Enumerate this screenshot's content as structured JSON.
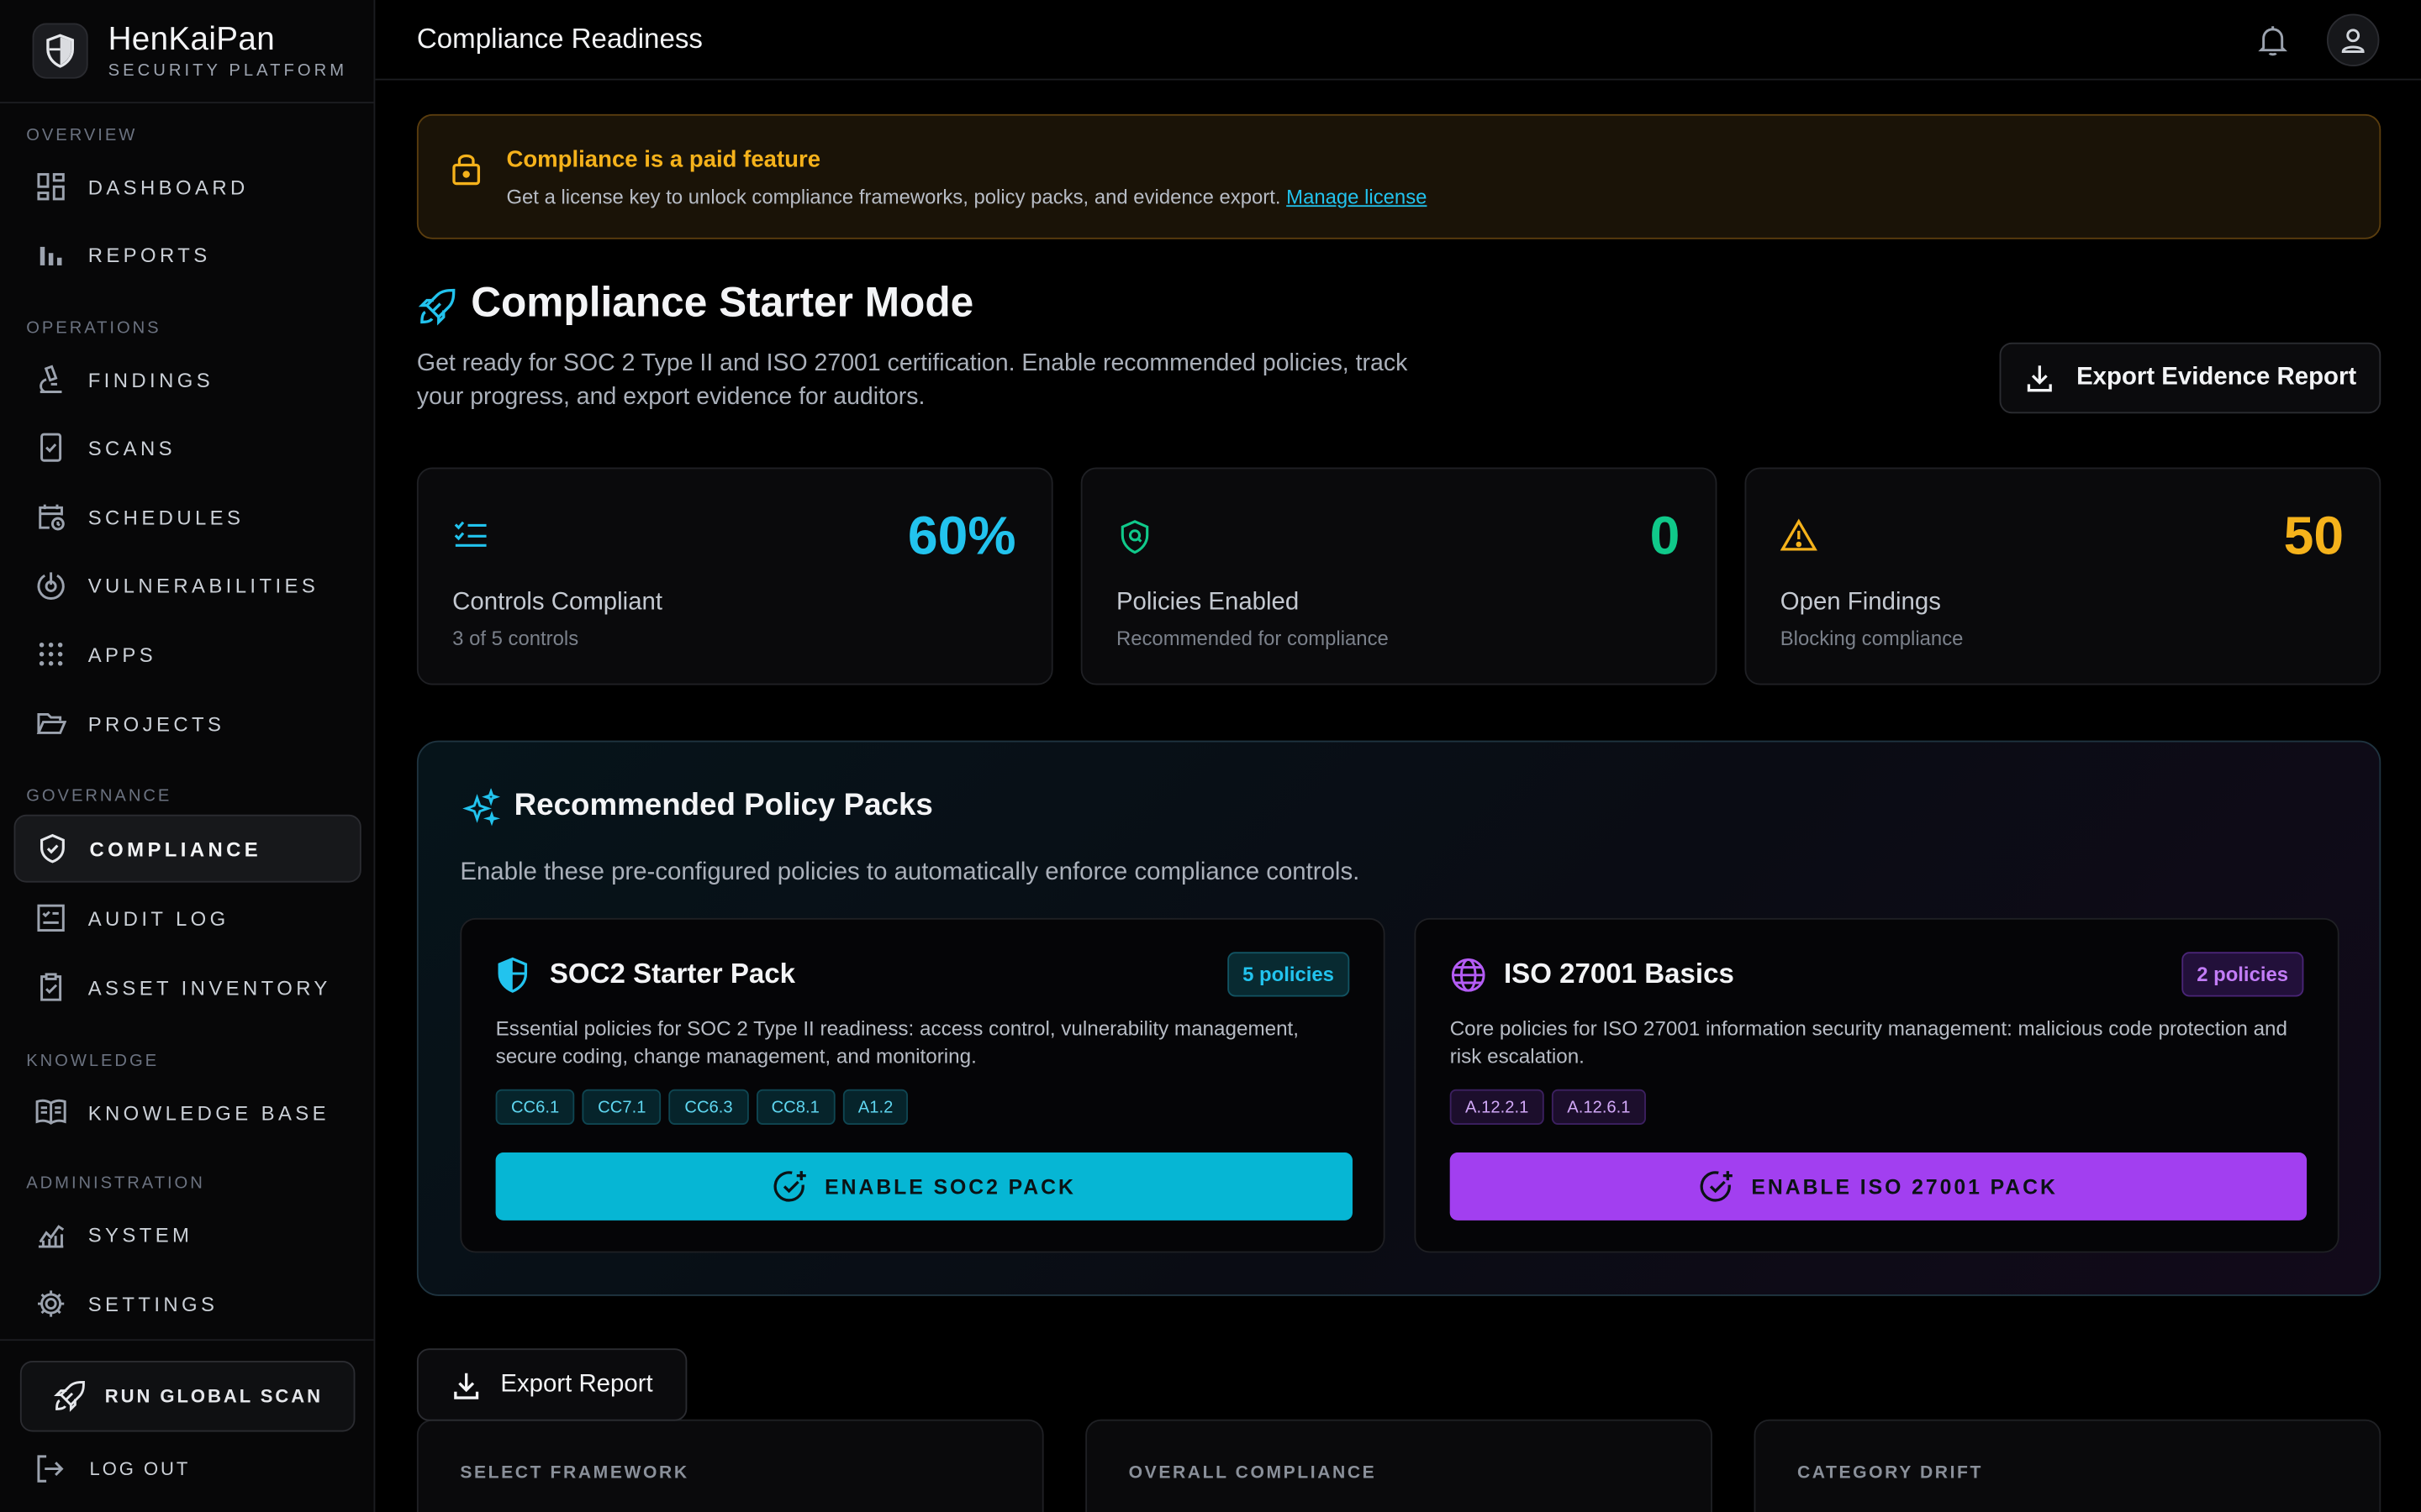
{
  "brand": {
    "name": "HenKaiPan",
    "subtitle": "SECURITY PLATFORM"
  },
  "nav": {
    "overview": "OVERVIEW",
    "operations": "OPERATIONS",
    "governance": "GOVERNANCE",
    "knowledge": "KNOWLEDGE",
    "administration": "ADMINISTRATION",
    "items": {
      "dashboard": "DASHBOARD",
      "reports": "REPORTS",
      "findings": "FINDINGS",
      "scans": "SCANS",
      "schedules": "SCHEDULES",
      "vulnerabilities": "VULNERABILITIES",
      "apps": "APPS",
      "projects": "PROJECTS",
      "compliance": "COMPLIANCE",
      "audit_log": "AUDIT LOG",
      "asset_inventory": "ASSET INVENTORY",
      "knowledge_base": "KNOWLEDGE BASE",
      "system": "SYSTEM",
      "settings": "SETTINGS"
    },
    "active": "compliance",
    "run_global_scan": "RUN GLOBAL SCAN",
    "log_out": "LOG OUT"
  },
  "header": {
    "title": "Compliance Readiness"
  },
  "banner": {
    "title": "Compliance is a paid feature",
    "text": "Get a license key to unlock compliance frameworks, policy packs, and evidence export.",
    "link": "Manage license"
  },
  "starter": {
    "title": "Compliance Starter Mode",
    "description": "Get ready for SOC 2 Type II and ISO 27001 certification. Enable recommended policies, track your progress, and export evidence for auditors.",
    "export_button": "Export Evidence Report"
  },
  "stats": [
    {
      "value": "60%",
      "label": "Controls Compliant",
      "sub": "3 of 5 controls",
      "color": "#22c3ee"
    },
    {
      "value": "0",
      "label": "Policies Enabled",
      "sub": "Recommended for compliance",
      "color": "#10c98a"
    },
    {
      "value": "50",
      "label": "Open Findings",
      "sub": "Blocking compliance",
      "color": "#f5b21b"
    }
  ],
  "packs": {
    "title": "Recommended Policy Packs",
    "description": "Enable these pre-configured policies to automatically enforce compliance controls.",
    "items": [
      {
        "title": "SOC2 Starter Pack",
        "badge": "5 policies",
        "description": "Essential policies for SOC 2 Type II readiness: access control, vulnerability management, secure coding, change management, and monitoring.",
        "tags": [
          "CC6.1",
          "CC7.1",
          "CC6.3",
          "CC8.1",
          "A1.2"
        ],
        "button": "ENABLE SOC2 PACK",
        "accent": "#06b6d4"
      },
      {
        "title": "ISO 27001 Basics",
        "badge": "2 policies",
        "description": "Core policies for ISO 27001 information security management: malicious code protection and risk escalation.",
        "tags": [
          "A.12.2.1",
          "A.12.6.1"
        ],
        "button": "ENABLE ISO 27001 PACK",
        "accent": "#a23ff0"
      }
    ]
  },
  "report": {
    "export_button": "Export Report",
    "cards": [
      "SELECT FRAMEWORK",
      "OVERALL COMPLIANCE",
      "CATEGORY DRIFT"
    ]
  },
  "icons": {
    "accent_cyan": "#22c3ee",
    "accent_purple": "#a23ff0",
    "warning_amber": "#f5b21b"
  }
}
